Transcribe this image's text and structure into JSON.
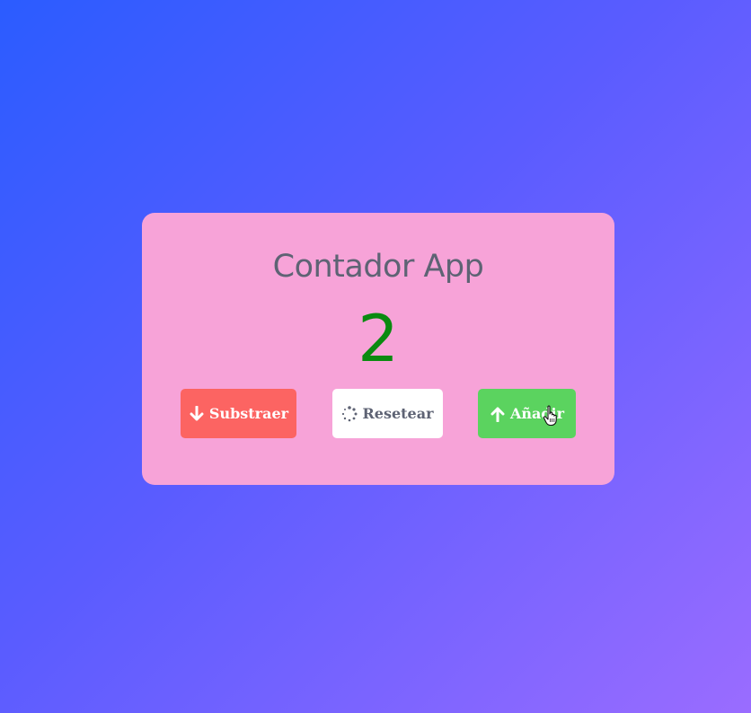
{
  "app": {
    "title": "Contador App",
    "counter_value": "2"
  },
  "buttons": {
    "subtract": {
      "label": "Substraer",
      "icon": "arrow-down-icon",
      "color": "#fc6462"
    },
    "reset": {
      "label": "Resetear",
      "icon": "spinner-icon",
      "color": "#ffffff"
    },
    "add": {
      "label": "Añadir",
      "icon": "arrow-up-icon",
      "color": "#5bd35f"
    }
  },
  "colors": {
    "card_background": "#f7a3d8",
    "counter_color": "#0a8a10",
    "title_color": "#5e6374"
  }
}
